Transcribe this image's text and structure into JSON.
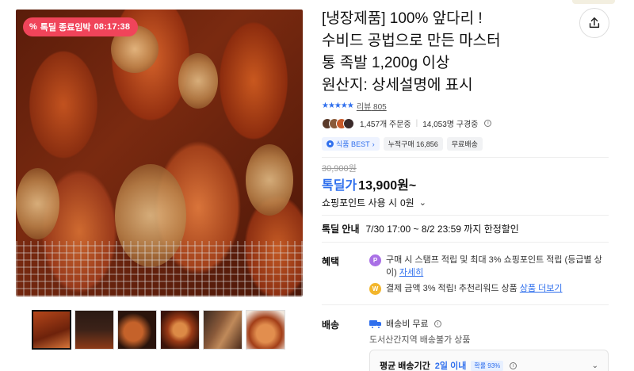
{
  "product": {
    "title_lines": [
      "[냉장제품] 100% 앞다리 !",
      "수비드 공법으로 만든 마스터",
      "통 족발 1,200g 이상",
      "원산지: 상세설명에 표시"
    ]
  },
  "deal_badge": {
    "icon": "%",
    "label": "톡딜 종료임박",
    "timer": "08:17:38"
  },
  "rating": {
    "stars": "★★★★★",
    "review_label": "리뷰",
    "review_count": "805"
  },
  "social": {
    "orders": "1,457개 주문중",
    "subscribers": "14,053명 구경중"
  },
  "tags": [
    "식품 BEST",
    "누적구매 16,856",
    "무료배송"
  ],
  "price": {
    "original": "30,900원",
    "label": "톡딜가",
    "value": "13,900원~"
  },
  "points": {
    "text": "쇼핑포인트 사용 시",
    "value": "0원"
  },
  "deal_info": {
    "label": "톡딜 안내",
    "value": "7/30 17:00 ~ 8/2 23:59 까지 한정할인"
  },
  "benefit": {
    "label": "혜택",
    "items": [
      {
        "icon": "P",
        "text": "구매 시 스탬프 적립 및 최대 3% 쇼핑포인트 적립 (등급별 상이)",
        "link": "자세히"
      },
      {
        "icon": "W",
        "text": "결제 금액 3% 적립! 추천리워드 상품",
        "link": "상품 더보기"
      }
    ]
  },
  "shipping": {
    "label": "배송",
    "fee": "배송비 무료",
    "note": "도서산간지역 배송불가 상품",
    "avg_label": "평균 배송기간",
    "avg_value": "2일 이내",
    "prob": "확률 93%"
  },
  "colors": {
    "accent": "#2f6fed",
    "badge": "#f0445a"
  },
  "icons": {
    "share": "share-icon",
    "info": "info-icon",
    "truck": "truck-icon"
  }
}
